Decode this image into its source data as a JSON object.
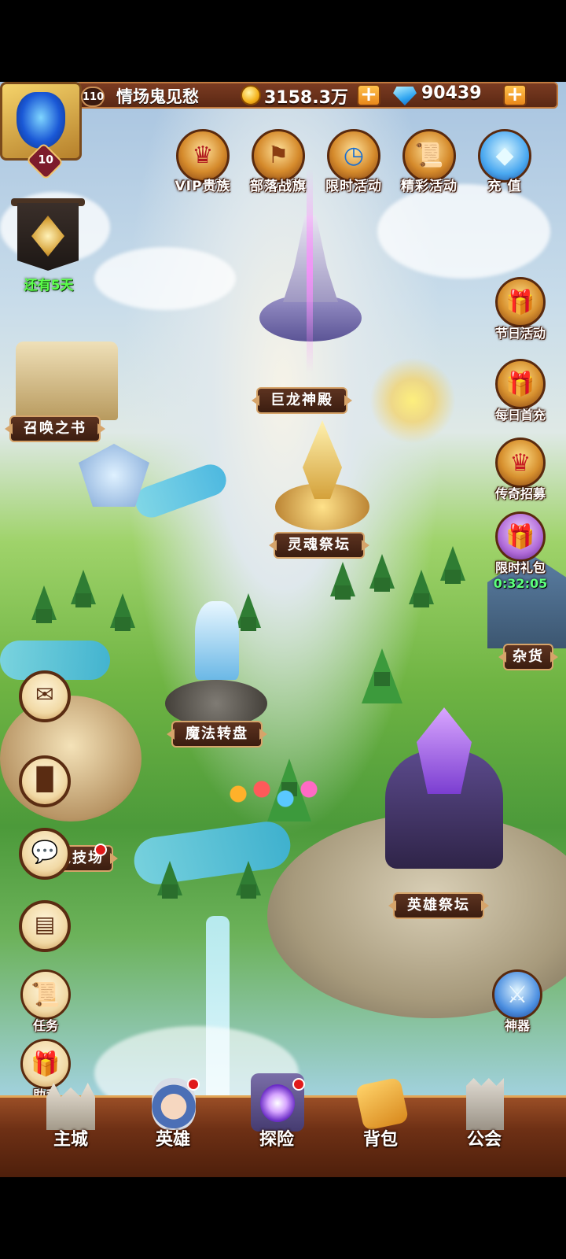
{
  "player": {
    "level": "110",
    "avatar_level": "10",
    "name": "情场鬼见愁",
    "gold": "3158.3万",
    "gems": "90439"
  },
  "top_features": [
    {
      "label": "VIP贵族",
      "icon": "crown-icon"
    },
    {
      "label": "部落战旗",
      "icon": "banner-icon"
    },
    {
      "label": "限时活动",
      "icon": "clock-icon"
    },
    {
      "label": "精彩活动",
      "icon": "scroll-icon"
    },
    {
      "label": "充 值",
      "icon": "diamond-icon"
    }
  ],
  "season_banner": {
    "label": "还有5天"
  },
  "right_features": [
    {
      "label": "节日活动",
      "icon": "treasure-chest-icon"
    },
    {
      "label": "每日首充",
      "icon": "gift-box-icon"
    },
    {
      "label": "传奇招募",
      "icon": "chalice-icon"
    },
    {
      "label": "限时礼包",
      "icon": "gift-clock-icon",
      "timer": "0:32:05"
    }
  ],
  "map_labels": {
    "dragon_temple": "巨龙神殿",
    "summon_book": "召唤之书",
    "soul_altar": "灵魂祭坛",
    "magic_wheel": "魔法转盘",
    "grocery": "杂货",
    "arena": "竞技场",
    "hero_altar": "英雄祭坛",
    "left_cut": "赏"
  },
  "left_buttons": [
    {
      "name": "mail",
      "icon": "mail-icon"
    },
    {
      "name": "ranking",
      "icon": "ranking-icon"
    },
    {
      "name": "chat",
      "icon": "chat-icon"
    },
    {
      "name": "friends",
      "icon": "contacts-icon"
    }
  ],
  "task": {
    "label": "任务"
  },
  "helper": {
    "label": "助手"
  },
  "artifact": {
    "label": "神器"
  },
  "bottom_nav": [
    {
      "label": "主城",
      "icon": "castle-icon"
    },
    {
      "label": "英雄",
      "icon": "hero-portrait-icon"
    },
    {
      "label": "探险",
      "icon": "portal-icon"
    },
    {
      "label": "背包",
      "icon": "backpack-icon"
    },
    {
      "label": "公会",
      "icon": "guild-tower-icon"
    }
  ],
  "colors": {
    "bar_brown": "#5a2813",
    "gold_trim": "#d6a46a",
    "timer_green": "#5cff7c",
    "notify_red": "#e01a1a"
  }
}
